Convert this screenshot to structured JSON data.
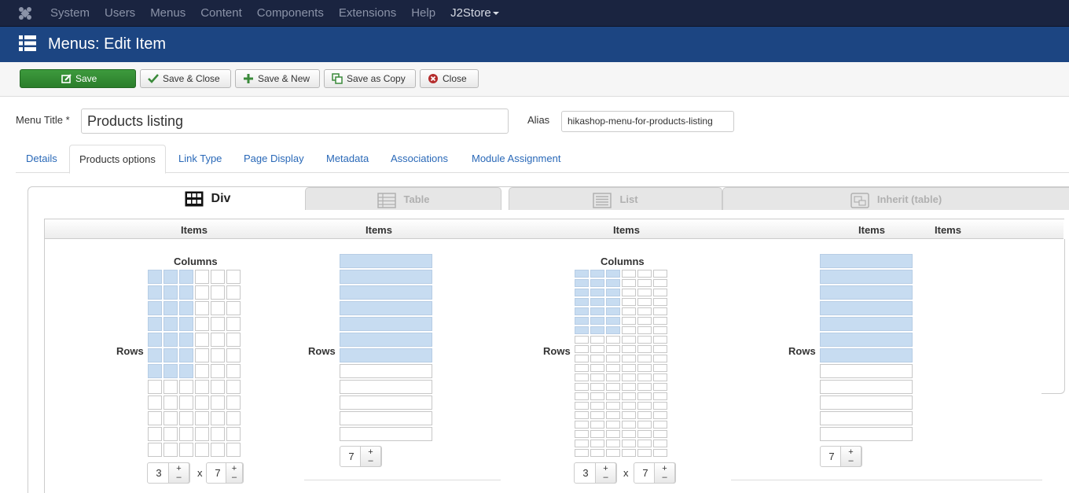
{
  "topnav": {
    "items": [
      "System",
      "Users",
      "Menus",
      "Content",
      "Components",
      "Extensions",
      "Help",
      "J2Store"
    ]
  },
  "header": {
    "title": "Menus: Edit Item"
  },
  "toolbar": {
    "save": "Save",
    "save_close": "Save & Close",
    "save_new": "Save & New",
    "save_copy": "Save as Copy",
    "close": "Close"
  },
  "form": {
    "menu_title_label": "Menu Title *",
    "menu_title_value": "Products listing",
    "alias_label": "Alias",
    "alias_value": "hikashop-menu-for-products-listing"
  },
  "tabs": [
    "Details",
    "Products options",
    "Link Type",
    "Page Display",
    "Metadata",
    "Associations",
    "Module Assignment"
  ],
  "layout_tabs": {
    "div": "Div",
    "table": "Table",
    "list": "List",
    "inherit": "Inherit (table)"
  },
  "panels": {
    "items_headers": [
      "Items",
      "Items",
      "Items",
      "Items",
      "Items"
    ],
    "columns_label": "Columns",
    "rows_label": "Rows",
    "div_grid": {
      "cols": 3,
      "rows": 7
    },
    "table_rows": 7,
    "list_grid": {
      "cols": 3,
      "rows": 7
    },
    "inherit_rows": 7,
    "spin": {
      "cols": "3",
      "rows": "7",
      "x": "x",
      "plus": "+",
      "minus": "–"
    }
  },
  "colors": {
    "topnav": "#1a2440",
    "header": "#1c4582",
    "save": "#2b7e2b",
    "cell_on": "#c7dcf1",
    "link": "#2a69b8"
  }
}
